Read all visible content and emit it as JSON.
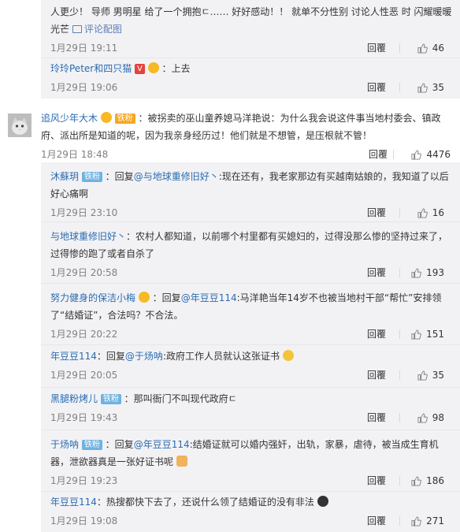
{
  "top_replies": [
    {
      "text": "人更少！ 导师 男明星 给了一个拥抱ㄷ…… 好好感动！！ 就单不分性别 讨论人性恶 时 闪耀暖暖光芒",
      "pic_link": "评论配图",
      "time": "1月29日 19:11",
      "reply_label": "回覆",
      "likes": "46"
    },
    {
      "user": "玲玲Peter和四只猫",
      "text": "：上去",
      "time": "1月29日 19:06",
      "reply_label": "回覆",
      "likes": "35"
    }
  ],
  "main_comment": {
    "user": "追风少年大木",
    "badge": "铁粉",
    "text": "：被拐卖的巫山童养媳马洋艳说：为什么我会说这件事当地村委会、镇政府、派出所是知道的呢，因为我亲身经历过！他们就是不想管，是压根就不管！",
    "time": "1月29日 18:48",
    "reply_label": "回覆",
    "likes": "4476"
  },
  "sub_replies": [
    {
      "user": "沐蘇玥",
      "badge": "铁粉",
      "prefix": "：回复",
      "mention": "@与地球重修旧好丶",
      "text": ":现在还有，我老家那边有买越南姑娘的，我知道了以后好心痛啊",
      "time": "1月29日 23:10",
      "reply_label": "回覆",
      "likes": "16"
    },
    {
      "user": "与地球重修旧好丶",
      "text": "：农村人都知道，以前哪个村里都有买媳妇的，过得没那么惨的坚持过来了，过得惨的跑了或者自杀了",
      "time": "1月29日 20:58",
      "reply_label": "回覆",
      "likes": "193"
    },
    {
      "user": "努力健身的保洁小梅",
      "prefix": "：回复",
      "mention": "@年豆豆114",
      "text": ":马洋艳当年14岁不也被当地村干部“帮忙”安排领了“结婚证”，合法吗？不合法。",
      "time": "1月29日 20:22",
      "reply_label": "回覆",
      "likes": "151"
    },
    {
      "user": "年豆豆114",
      "prefix": "：回复",
      "mention": "@于炀呐",
      "text": ":政府工作人员就认这张证书",
      "time": "1月29日 20:05",
      "reply_label": "回覆",
      "likes": "35"
    },
    {
      "user": "黑腿粉烤儿",
      "badge": "铁粉",
      "text": "：那叫衙门不叫现代政府ㄷ",
      "time": "1月29日 19:43",
      "reply_label": "回覆",
      "likes": "98"
    },
    {
      "user": "于炀呐",
      "badge": "铁粉",
      "prefix": "：回复",
      "mention": "@年豆豆114",
      "text": ":结婚证就可以婚内强奸，出轨，家暴，虐待，被当成生育机器，泄欲器真是一张好证书呢",
      "time": "1月29日 19:23",
      "reply_label": "回覆",
      "likes": "186"
    },
    {
      "user": "年豆豆114",
      "text": "：热搜都快下去了，还说什么领了结婚证的没有非法",
      "time": "1月29日 19:08",
      "reply_label": "回覆",
      "likes": "271"
    }
  ]
}
